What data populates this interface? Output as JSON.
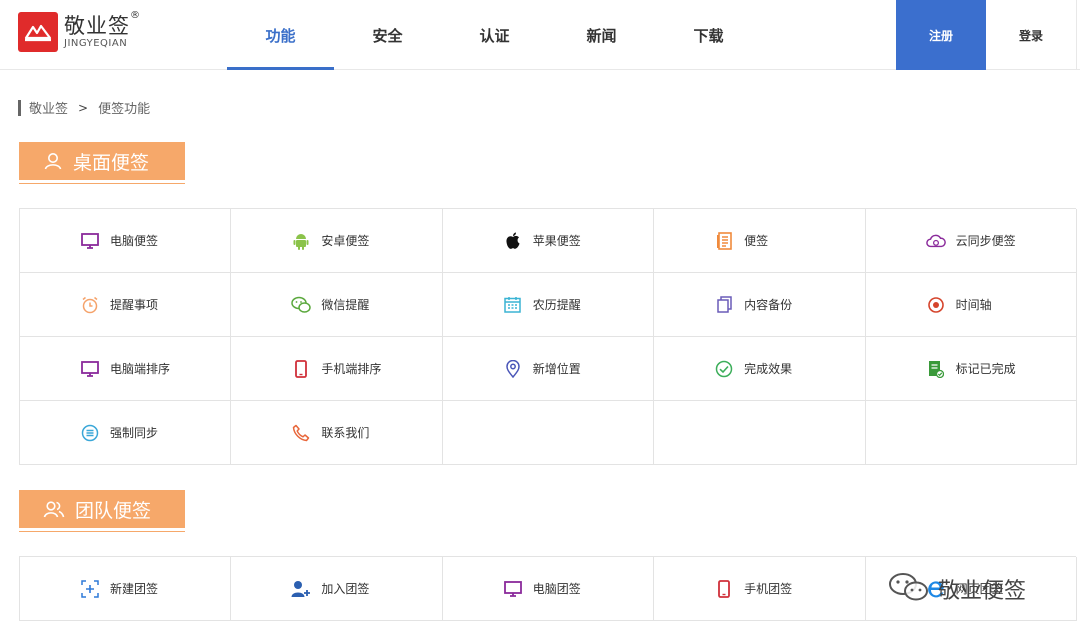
{
  "header": {
    "logo_cn": "敬业签",
    "logo_reg": "®",
    "logo_en": "JINGYEQIAN",
    "nav": [
      {
        "label": "功能",
        "active": true
      },
      {
        "label": "安全",
        "active": false
      },
      {
        "label": "认证",
        "active": false
      },
      {
        "label": "新闻",
        "active": false
      },
      {
        "label": "下载",
        "active": false
      }
    ],
    "register_label": "注册",
    "login_label": "登录",
    "accent_color": "#3b6fce"
  },
  "breadcrumb": {
    "root": "敬业签",
    "separator": ">",
    "current": "便签功能"
  },
  "sections": {
    "desktop": {
      "title": "桌面便签",
      "items": [
        {
          "label": "电脑便签",
          "icon": "monitor-icon"
        },
        {
          "label": "安卓便签",
          "icon": "android-icon"
        },
        {
          "label": "苹果便签",
          "icon": "apple-icon"
        },
        {
          "label": "便签",
          "icon": "notepad-icon"
        },
        {
          "label": "云同步便签",
          "icon": "cloud-sync-icon"
        },
        {
          "label": "提醒事项",
          "icon": "alarm-clock-icon"
        },
        {
          "label": "微信提醒",
          "icon": "wechat-icon"
        },
        {
          "label": "农历提醒",
          "icon": "calendar-icon"
        },
        {
          "label": "内容备份",
          "icon": "copy-icon"
        },
        {
          "label": "时间轴",
          "icon": "timeline-icon"
        },
        {
          "label": "电脑端排序",
          "icon": "monitor-icon"
        },
        {
          "label": "手机端排序",
          "icon": "phone-icon"
        },
        {
          "label": "新增位置",
          "icon": "location-pin-icon"
        },
        {
          "label": "完成效果",
          "icon": "check-circle-icon"
        },
        {
          "label": "标记已完成",
          "icon": "doc-check-icon"
        },
        {
          "label": "强制同步",
          "icon": "sync-list-icon"
        },
        {
          "label": "联系我们",
          "icon": "phone-call-icon"
        }
      ]
    },
    "team": {
      "title": "团队便签",
      "items": [
        {
          "label": "新建团签",
          "icon": "add-frame-icon"
        },
        {
          "label": "加入团签",
          "icon": "add-user-icon"
        },
        {
          "label": "电脑团签",
          "icon": "monitor-icon"
        },
        {
          "label": "手机团签",
          "icon": "phone-icon"
        },
        {
          "label": "网页团签",
          "icon": "ie-icon"
        }
      ]
    }
  },
  "watermark": {
    "text": "敬业便签"
  }
}
